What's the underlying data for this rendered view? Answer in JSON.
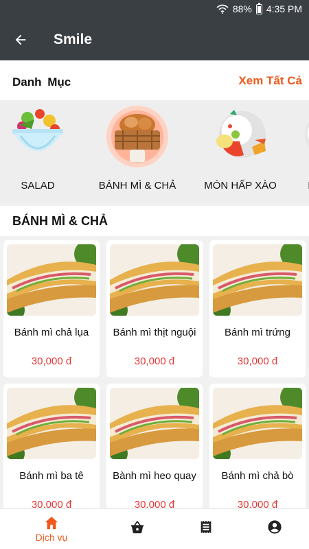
{
  "status_bar": {
    "battery": "88%",
    "time": "4:35 PM",
    "icons": [
      "wifi-icon",
      "battery-icon"
    ]
  },
  "app_bar": {
    "title": "Smile",
    "back_icon": "arrow-left-icon"
  },
  "categories": {
    "title": "Danh  Mục",
    "view_all": "Xem Tất Cả",
    "items": [
      {
        "label": "SALAD",
        "icon": "salad-icon"
      },
      {
        "label": "BÁNH MÌ & CHẢ",
        "icon": "bread-basket-icon"
      },
      {
        "label": "MÓN HẤP XÀO",
        "icon": "steamed-dish-icon"
      },
      {
        "label": "MÓN B",
        "icon": "food-icon"
      }
    ]
  },
  "section": {
    "title": "BÁNH MÌ & CHẢ"
  },
  "products": [
    {
      "name": "Bánh mì chả lụa",
      "price": "30,000 đ"
    },
    {
      "name": "Bánh mì thịt nguội",
      "price": "30,000 đ"
    },
    {
      "name": "Bánh mì trứng",
      "price": "30,000 đ"
    },
    {
      "name": "Bánh mì ba tê",
      "price": "30,000 đ"
    },
    {
      "name": "Bành mì heo quay",
      "price": "30,000 đ"
    },
    {
      "name": "Bánh mì chả bò",
      "price": "30,000 đ"
    }
  ],
  "bottom_nav": [
    {
      "label": "Dịch vụ",
      "icon": "home-icon",
      "active": true
    },
    {
      "label": "",
      "icon": "basket-icon"
    },
    {
      "label": "",
      "icon": "receipt-icon"
    },
    {
      "label": "",
      "icon": "account-icon"
    }
  ],
  "colors": {
    "accent": "#f05a1e",
    "price": "#e53935",
    "bar": "#3a3f44"
  }
}
